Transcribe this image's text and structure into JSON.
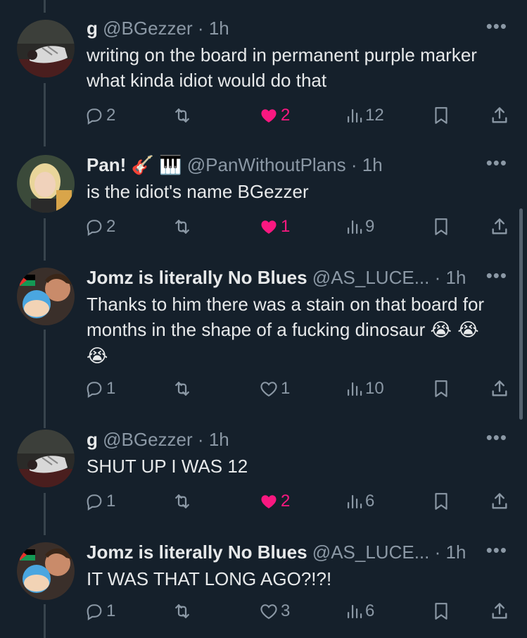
{
  "tweets": [
    {
      "name": "g",
      "handle": "@BGezzer",
      "dot": "·",
      "time": "1h",
      "text": "writing on the board in permanent purple marker what kinda idiot would do that",
      "replies": "2",
      "retweets": "",
      "likes": "2",
      "liked": true,
      "views": "12"
    },
    {
      "name": "Pan! 🎸 🎹",
      "handle": "@PanWithoutPlans",
      "dot": "·",
      "time": "1h",
      "text": "is the idiot's name BGezzer",
      "replies": "2",
      "retweets": "",
      "likes": "1",
      "liked": true,
      "views": "9"
    },
    {
      "name": "Jomz is literally No Blues",
      "handle": "@AS_LUCE...",
      "dot": "·",
      "time": "1h",
      "text": "Thanks to him there was a stain on that board for months in the shape of a fucking dinosaur",
      "emoji": "😭 😭 😭",
      "replies": "1",
      "retweets": "",
      "likes": "1",
      "liked": false,
      "views": "10"
    },
    {
      "name": "g",
      "handle": "@BGezzer",
      "dot": "·",
      "time": "1h",
      "text": "SHUT UP I WAS 12",
      "replies": "1",
      "retweets": "",
      "likes": "2",
      "liked": true,
      "views": "6"
    },
    {
      "name": "Jomz is literally No Blues",
      "handle": "@AS_LUCE...",
      "dot": "·",
      "time": "1h",
      "text": "IT WAS THAT LONG AGO?!?!",
      "replies": "1",
      "retweets": "",
      "likes": "3",
      "liked": false,
      "views": "6"
    }
  ],
  "more_label": "•••",
  "icons": {
    "reply": "reply-icon",
    "retweet": "retweet-icon",
    "like": "heart-icon",
    "views": "views-icon",
    "bookmark": "bookmark-icon",
    "share": "share-icon"
  },
  "colors": {
    "background": "#15202b",
    "text": "#e7e9ea",
    "muted": "#8b98a5",
    "like": "#f91880"
  }
}
